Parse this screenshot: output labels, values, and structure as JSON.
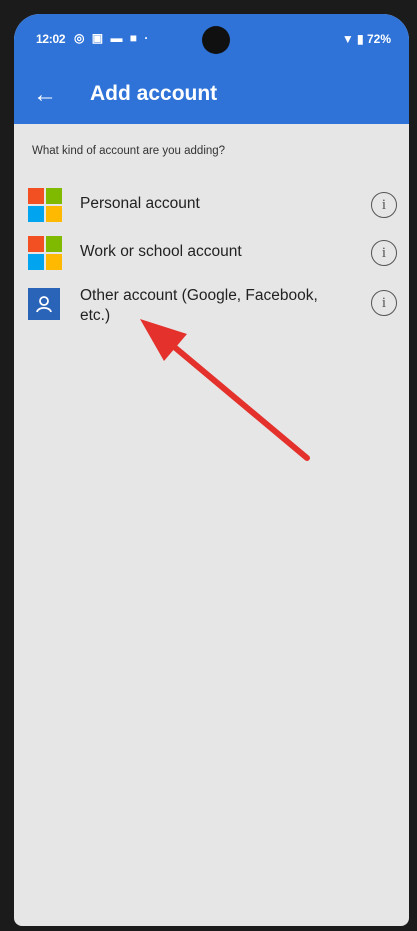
{
  "status_bar": {
    "time": "12:02",
    "left_icons": "◎ ▣ ▬ ■ ·",
    "right": "▼ ▮ 72%"
  },
  "appbar": {
    "back_icon": "←",
    "title": "Add account"
  },
  "question": "What kind of account are you adding?",
  "accounts": [
    {
      "label": "Personal account",
      "icon": "microsoft-logo-icon",
      "info_icon": "i"
    },
    {
      "label": "Work or school account",
      "icon": "microsoft-logo-icon",
      "info_icon": "i"
    },
    {
      "label": "Other account (Google, Facebook,",
      "label2": "etc.)",
      "icon": "user-icon",
      "info_icon": "i"
    }
  ],
  "colors": {
    "appbar": "#2f73d8",
    "background": "#e6e6e6",
    "ms_red": "#f25022",
    "ms_green": "#7fba00",
    "ms_blue": "#00a4ef",
    "ms_yellow": "#ffb900",
    "annotation_arrow": "#e4312b"
  }
}
